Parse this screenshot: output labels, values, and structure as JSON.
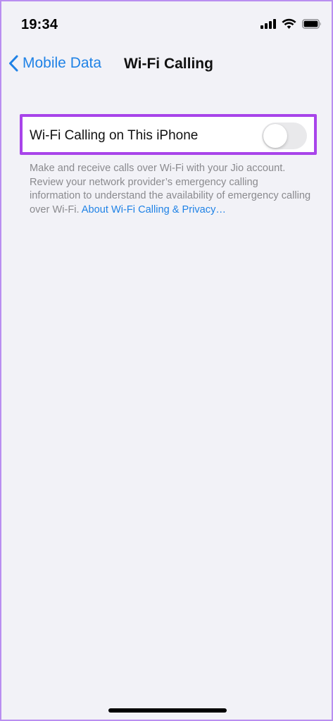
{
  "status_bar": {
    "time": "19:34",
    "icons": [
      "cellular-signal-icon",
      "wifi-icon",
      "battery-icon"
    ]
  },
  "nav": {
    "back_label": "Mobile Data",
    "title": "Wi-Fi Calling"
  },
  "settings": {
    "wifi_calling_label": "Wi-Fi Calling on This iPhone",
    "wifi_calling_enabled": false
  },
  "footer": {
    "description": "Make and receive calls over Wi-Fi with your Jio account. Review your network provider’s emergency calling information to understand the availability of emergency calling over Wi-Fi.",
    "link_text": "About Wi-Fi Calling & Privacy…"
  },
  "colors": {
    "accent": "#1f82e6",
    "background": "#f2f2f7",
    "highlight_border": "#a844ea",
    "toggle_off": "#e9e9eb",
    "footer_text": "#8a8a8e"
  }
}
